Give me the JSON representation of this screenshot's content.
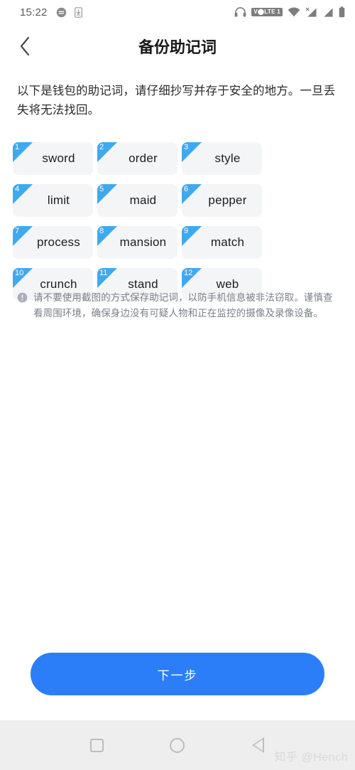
{
  "status_bar": {
    "time": "15:22",
    "left_icons": [
      "message-icon",
      "download-icon"
    ],
    "right_icons": [
      "headphones-icon",
      "volte-badge",
      "wifi-icon",
      "signal-1-icon",
      "signal-2-icon",
      "battery-icon"
    ],
    "volte_label": "V⬤LTE 1"
  },
  "header": {
    "back_icon": "chevron-left-icon",
    "title": "备份助记词"
  },
  "main": {
    "description": "以下是钱包的助记词，请仔细抄写并存于安全的地方。一旦丢失将无法找回。",
    "mnemonic_words": [
      {
        "index": "1",
        "word": "sword"
      },
      {
        "index": "2",
        "word": "order"
      },
      {
        "index": "3",
        "word": "style"
      },
      {
        "index": "4",
        "word": "limit"
      },
      {
        "index": "5",
        "word": "maid"
      },
      {
        "index": "6",
        "word": "pepper"
      },
      {
        "index": "7",
        "word": "process"
      },
      {
        "index": "8",
        "word": "mansion"
      },
      {
        "index": "9",
        "word": "match"
      },
      {
        "index": "10",
        "word": "crunch"
      },
      {
        "index": "11",
        "word": "stand"
      },
      {
        "index": "12",
        "word": "web"
      }
    ],
    "warning_icon": "exclamation-circle-icon",
    "warning_text": "请不要使用截图的方式保存助记词，以防手机信息被非法窃取。谨慎查看周围环境，确保身边没有可疑人物和正在监控的摄像及录像设备。"
  },
  "footer": {
    "next_label": "下一步"
  },
  "nav_bar": {
    "recents_icon": "square-icon",
    "home_icon": "circle-icon",
    "back_icon": "triangle-left-icon"
  },
  "watermark": "知乎 @Hench",
  "colors": {
    "accent_blue": "#2b7ef7",
    "badge_blue": "#3fa9f0",
    "card_bg": "#f4f5f7",
    "warning_text": "#7b8189",
    "nav_bg": "#eeeeee"
  }
}
